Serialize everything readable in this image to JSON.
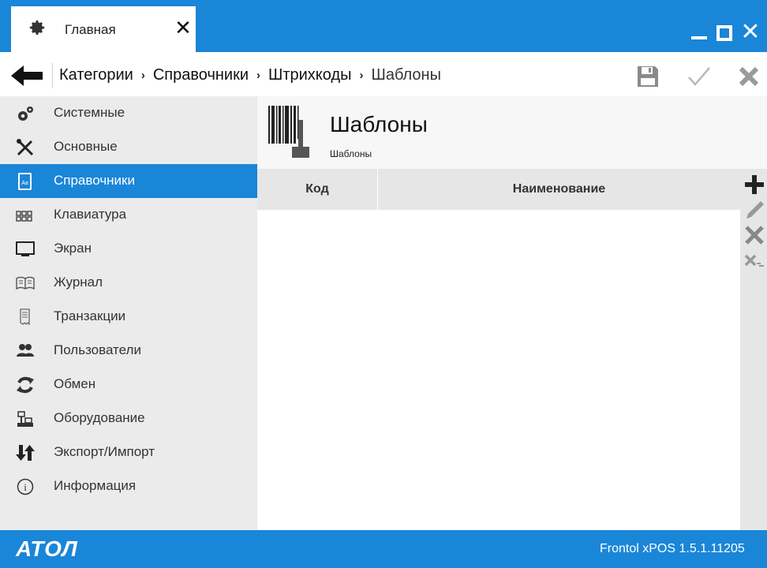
{
  "tab": {
    "label": "Главная",
    "icon": "gear-icon"
  },
  "breadcrumb": {
    "items": [
      "Категории",
      "Справочники",
      "Штрихкоды",
      "Шаблоны"
    ],
    "separator": "›"
  },
  "toolbar": {
    "save_icon": "save-icon",
    "apply_icon": "check-icon",
    "cancel_icon": "close-icon"
  },
  "sidebar": {
    "items": [
      {
        "label": "Системные",
        "icon": "gears-icon",
        "active": false
      },
      {
        "label": "Основные",
        "icon": "tools-icon",
        "active": false
      },
      {
        "label": "Справочники",
        "icon": "book-icon",
        "active": true
      },
      {
        "label": "Клавиатура",
        "icon": "keyboard-icon",
        "active": false
      },
      {
        "label": "Экран",
        "icon": "monitor-icon",
        "active": false
      },
      {
        "label": "Журнал",
        "icon": "journal-icon",
        "active": false
      },
      {
        "label": "Транзакции",
        "icon": "receipt-icon",
        "active": false
      },
      {
        "label": "Пользователи",
        "icon": "users-icon",
        "active": false
      },
      {
        "label": "Обмен",
        "icon": "exchange-icon",
        "active": false
      },
      {
        "label": "Оборудование",
        "icon": "equipment-icon",
        "active": false
      },
      {
        "label": "Экспорт/Импорт",
        "icon": "export-import-icon",
        "active": false
      },
      {
        "label": "Информация",
        "icon": "info-icon",
        "active": false
      }
    ]
  },
  "page": {
    "title": "Шаблоны",
    "subtitle": "Шаблоны",
    "icon": "barcode-icon"
  },
  "grid": {
    "columns": [
      "Код",
      "Наименование"
    ],
    "rows": []
  },
  "actions": [
    "add-icon",
    "edit-icon",
    "delete-icon",
    "delete-all-icon"
  ],
  "footer": {
    "logo": "АТОЛ",
    "version": "Frontol xPOS 1.5.1.11205"
  },
  "colors": {
    "accent": "#1a86d8",
    "sidebar_bg": "#ebebeb",
    "header_bg": "#e6e6e6"
  }
}
